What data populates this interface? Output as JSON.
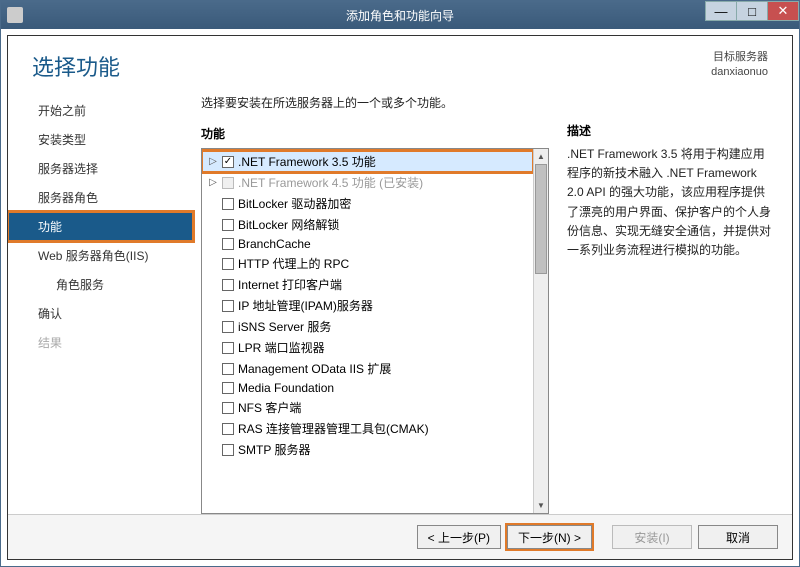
{
  "window": {
    "title": "添加角色和功能向导"
  },
  "header": {
    "page_title": "选择功能",
    "target_label": "目标服务器",
    "target_name": "danxiaonuo"
  },
  "sidebar": {
    "items": [
      {
        "label": "开始之前",
        "selected": false
      },
      {
        "label": "安装类型",
        "selected": false
      },
      {
        "label": "服务器选择",
        "selected": false
      },
      {
        "label": "服务器角色",
        "selected": false
      },
      {
        "label": "功能",
        "selected": true
      },
      {
        "label": "Web 服务器角色(IIS)",
        "selected": false
      },
      {
        "label": "角色服务",
        "selected": false,
        "indent": true
      },
      {
        "label": "确认",
        "selected": false
      },
      {
        "label": "结果",
        "selected": false,
        "disabled": true
      }
    ]
  },
  "content": {
    "instruction": "选择要安装在所选服务器上的一个或多个功能。",
    "features_label": "功能",
    "desc_label": "描述",
    "desc_text": ".NET Framework 3.5 将用于构建应用程序的新技术融入 .NET Framework 2.0 API 的强大功能，该应用程序提供了漂亮的用户界面、保护客户的个人身份信息、实现无缝安全通信，并提供对一系列业务流程进行模拟的功能。",
    "features": [
      {
        "label": ".NET Framework 3.5 功能",
        "checked": true,
        "expandable": true,
        "selected": true,
        "highlight": true
      },
      {
        "label": ".NET Framework 4.5 功能 (已安装)",
        "checked": false,
        "expandable": true,
        "disabled": true
      },
      {
        "label": "BitLocker 驱动器加密",
        "checked": false
      },
      {
        "label": "BitLocker 网络解锁",
        "checked": false
      },
      {
        "label": "BranchCache",
        "checked": false
      },
      {
        "label": "HTTP 代理上的 RPC",
        "checked": false
      },
      {
        "label": "Internet 打印客户端",
        "checked": false
      },
      {
        "label": "IP 地址管理(IPAM)服务器",
        "checked": false
      },
      {
        "label": "iSNS Server 服务",
        "checked": false
      },
      {
        "label": "LPR 端口监视器",
        "checked": false
      },
      {
        "label": "Management OData IIS 扩展",
        "checked": false
      },
      {
        "label": "Media Foundation",
        "checked": false
      },
      {
        "label": "NFS 客户端",
        "checked": false
      },
      {
        "label": "RAS 连接管理器管理工具包(CMAK)",
        "checked": false
      },
      {
        "label": "SMTP 服务器",
        "checked": false
      }
    ]
  },
  "footer": {
    "prev": "< 上一步(P)",
    "next": "下一步(N) >",
    "install": "安装(I)",
    "cancel": "取消"
  }
}
